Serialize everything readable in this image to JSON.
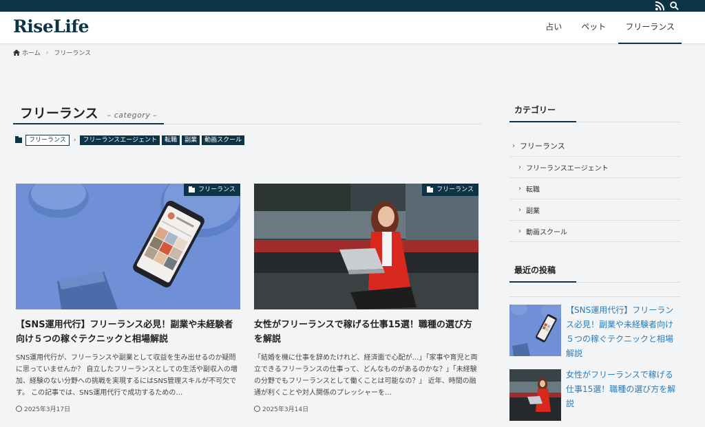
{
  "site": {
    "logo": "RiseLife"
  },
  "topbar": {
    "icons": [
      "rss-icon",
      "search-icon"
    ]
  },
  "nav": [
    "占い",
    "ペット",
    "フリーランス"
  ],
  "breadcrumb": {
    "home": "ホーム",
    "current": "フリーランス"
  },
  "archive": {
    "title": "フリーランス",
    "subtitle": "– category –",
    "parent_tag": "フリーランス",
    "child_tags": [
      "フリーランスエージェント",
      "転職",
      "副業",
      "動画スクール"
    ]
  },
  "posts": [
    {
      "category": "フリーランス",
      "title": "【SNS運用代行】フリーランス必見！副業や未経験者向け５つの稼ぐテクニックと相場解説",
      "excerpt": "SNS運用代行が、フリーランスや副業として収益を生み出せるのか疑問に思っていませんか？ 自立したフリーランスとしての生活や副収入の増加、経験のない分野への挑戦を実現するにはSNS管理スキルが不可欠です。 この記事では、SNS運用代行で成功するための…",
      "date": "2025年3月17日"
    },
    {
      "category": "フリーランス",
      "title": "女性がフリーランスで稼げる仕事15選！職種の選び方を解説",
      "excerpt": "「結婚を機に仕事を辞めたけれど、経済面で心配が…」「家事や育児と両立できるフリーランスの仕事って、どんなものがあるのかな？」「未経験の分野でもフリーランスとして働くことは可能なの？」 近年、時間の融通が利くことや対人関係のプレッシャーを…",
      "date": "2025年3月14日"
    }
  ],
  "sidebar": {
    "categories_title": "カテゴリー",
    "categories": [
      "フリーランス",
      "フリーランスエージェント",
      "転職",
      "副業",
      "動画スクール"
    ],
    "recent_title": "最近の投稿",
    "recent": [
      "【SNS運用代行】フリーランス必見！副業や未経験者向け５つの稼ぐテクニックと相場解説",
      "女性がフリーランスで稼げる仕事15選！職種の選び方を解説"
    ]
  },
  "colors": {
    "primary": "#0d3347",
    "link": "#2b7bb9",
    "background": "#f3f4f5"
  }
}
